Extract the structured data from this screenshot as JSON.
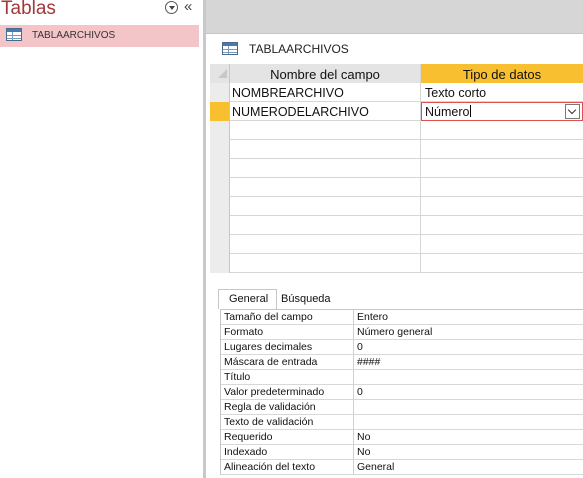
{
  "nav": {
    "title": "Tablas",
    "collapse_glyph": "«",
    "menu_icon": "dropdown-circle-icon",
    "items": [
      {
        "label": "TABLAARCHIVOS",
        "icon": "table-icon"
      }
    ]
  },
  "document": {
    "tab_label": "TABLAARCHIVOS",
    "tab_icon": "table-icon"
  },
  "grid": {
    "headers": {
      "field_name": "Nombre del campo",
      "data_type": "Tipo de datos"
    },
    "rows": [
      {
        "field_name": "NOMBREARCHIVO",
        "data_type": "Texto corto"
      },
      {
        "field_name": "NUMERODELARCHIVO",
        "data_type": "Número"
      }
    ],
    "current_row_color": "#f8c030",
    "header_highlight_color": "#f8c030"
  },
  "properties": {
    "tabs": {
      "general": "General",
      "lookup": "Búsqueda"
    },
    "rows": [
      {
        "label": "Tamaño del campo",
        "value": "Entero"
      },
      {
        "label": "Formato",
        "value": "Número general"
      },
      {
        "label": "Lugares decimales",
        "value": "0"
      },
      {
        "label": "Máscara de entrada",
        "value": "####"
      },
      {
        "label": "Título",
        "value": ""
      },
      {
        "label": "Valor predeterminado",
        "value": "0"
      },
      {
        "label": "Regla de validación",
        "value": ""
      },
      {
        "label": "Texto de validación",
        "value": ""
      },
      {
        "label": "Requerido",
        "value": "No"
      },
      {
        "label": "Indexado",
        "value": "No"
      },
      {
        "label": "Alineación del texto",
        "value": "General"
      }
    ]
  },
  "colors": {
    "nav_title": "#a4373a",
    "nav_selected": "#f4c5c8",
    "active_border": "#d9534f"
  }
}
